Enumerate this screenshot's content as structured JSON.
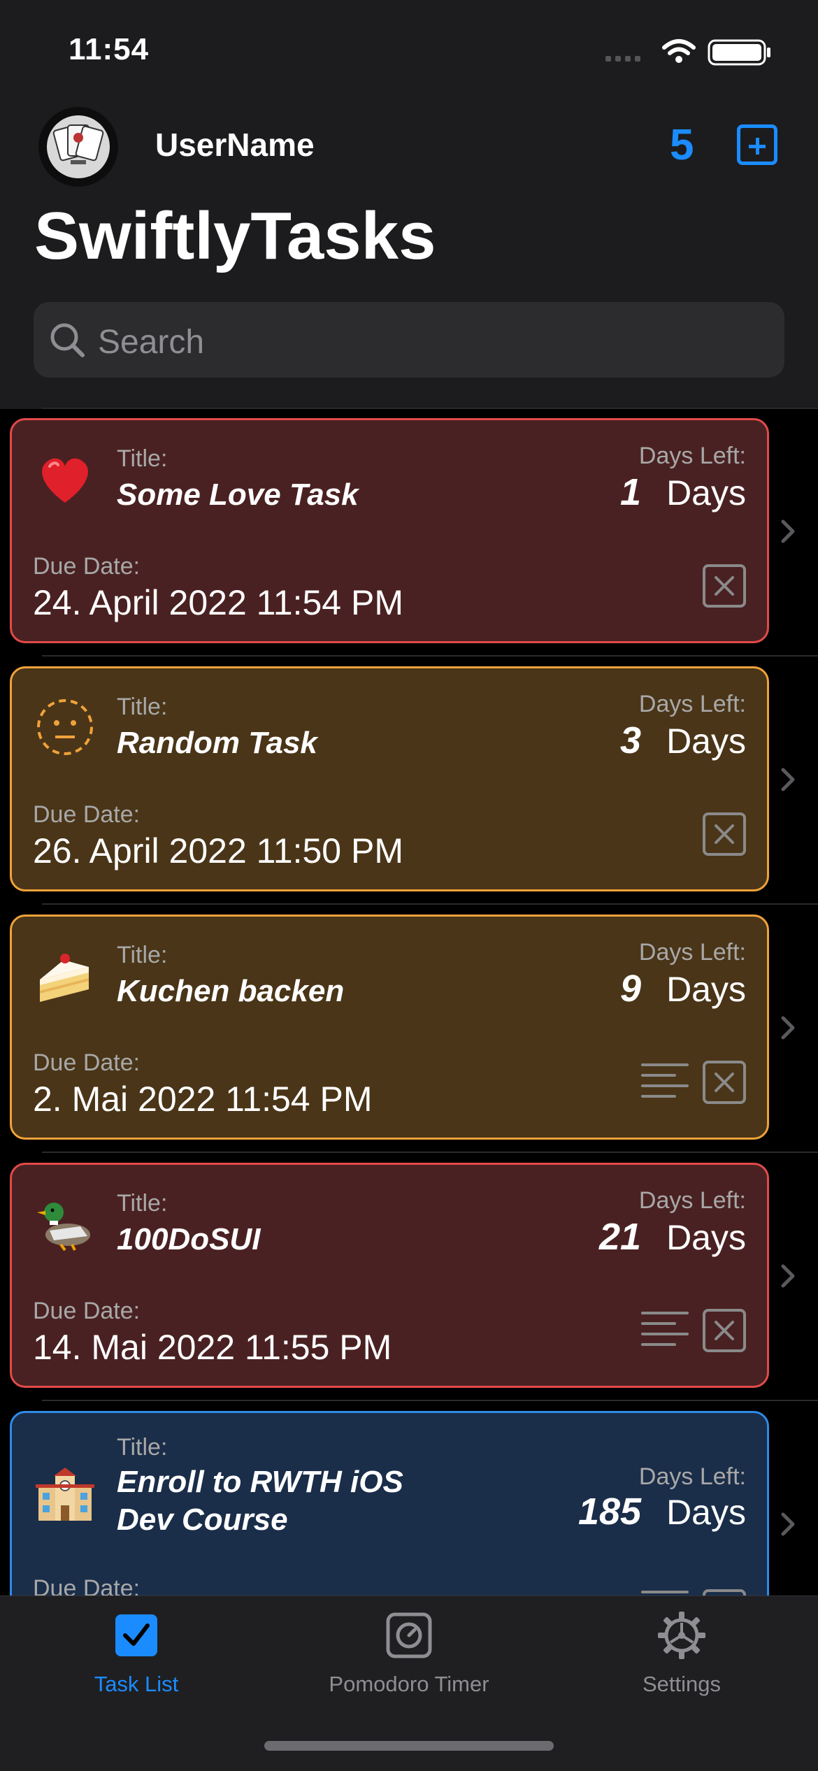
{
  "status": {
    "time": "11:54"
  },
  "header": {
    "username": "UserName",
    "task_count": "5",
    "title": "SwiftlyTasks"
  },
  "search": {
    "placeholder": "Search"
  },
  "labels": {
    "title": "Title:",
    "days_left": "Days Left:",
    "due_date": "Due Date:",
    "days": "Days"
  },
  "tasks": [
    {
      "emoji": "heart-emoji",
      "title": "Some Love Task",
      "days_left": "1",
      "due": "24. April 2022  11:54 PM",
      "has_notes": false,
      "bg": "#4a2122",
      "border": "#e24a4a"
    },
    {
      "emoji": "dotted-face-emoji",
      "title": "Random Task",
      "days_left": "3",
      "due": "26. April 2022  11:50 PM",
      "has_notes": false,
      "bg": "#4a3518",
      "border": "#f0a23a"
    },
    {
      "emoji": "cake-emoji",
      "title": "Kuchen backen",
      "days_left": "9",
      "due": "2. Mai 2022  11:54 PM",
      "has_notes": true,
      "bg": "#4a3518",
      "border": "#f0a23a"
    },
    {
      "emoji": "duck-emoji",
      "title": "100DoSUI",
      "days_left": "21",
      "due": "14. Mai 2022  11:55 PM",
      "has_notes": true,
      "bg": "#4a2122",
      "border": "#e24a4a"
    },
    {
      "emoji": "school-emoji",
      "title": "Enroll to RWTH iOS\nDev Course",
      "title_line1": "Enroll to RWTH iOS",
      "title_line2": "Dev Course",
      "days_left": "185",
      "due": "",
      "has_notes": true,
      "bg": "#1a2d49",
      "border": "#2f8be6"
    }
  ],
  "tabs": [
    {
      "label": "Task List",
      "icon": "checkmark-square-icon",
      "active": true
    },
    {
      "label": "Pomodoro Timer",
      "icon": "timer-icon",
      "active": false
    },
    {
      "label": "Settings",
      "icon": "gear-icon",
      "active": false
    }
  ],
  "colors": {
    "accent": "#1a8cff",
    "inactive": "#8e8e93"
  }
}
